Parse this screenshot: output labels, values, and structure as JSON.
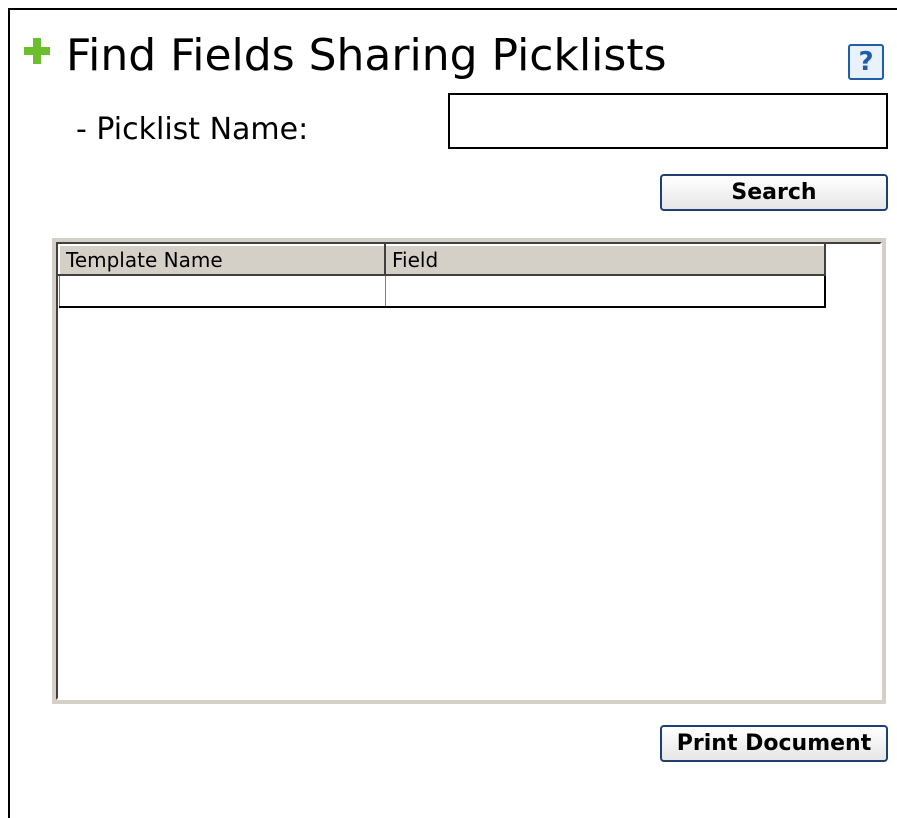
{
  "header": {
    "title": "Find Fields Sharing Picklists",
    "help_icon": "?"
  },
  "form": {
    "picklist_label": "- Picklist Name:",
    "picklist_value": "",
    "picklist_placeholder": "",
    "search_label": "Search"
  },
  "results": {
    "columns": [
      "Template Name",
      "Field"
    ],
    "rows": [
      [
        "",
        ""
      ]
    ]
  },
  "footer": {
    "print_label": "Print Document"
  },
  "colors": {
    "accent_plus": "#6bbf2c",
    "help_blue": "#1d5fa8",
    "header_gray": "#d4d0c8"
  },
  "icons": {
    "plus": "plus-icon",
    "help": "help-icon"
  }
}
